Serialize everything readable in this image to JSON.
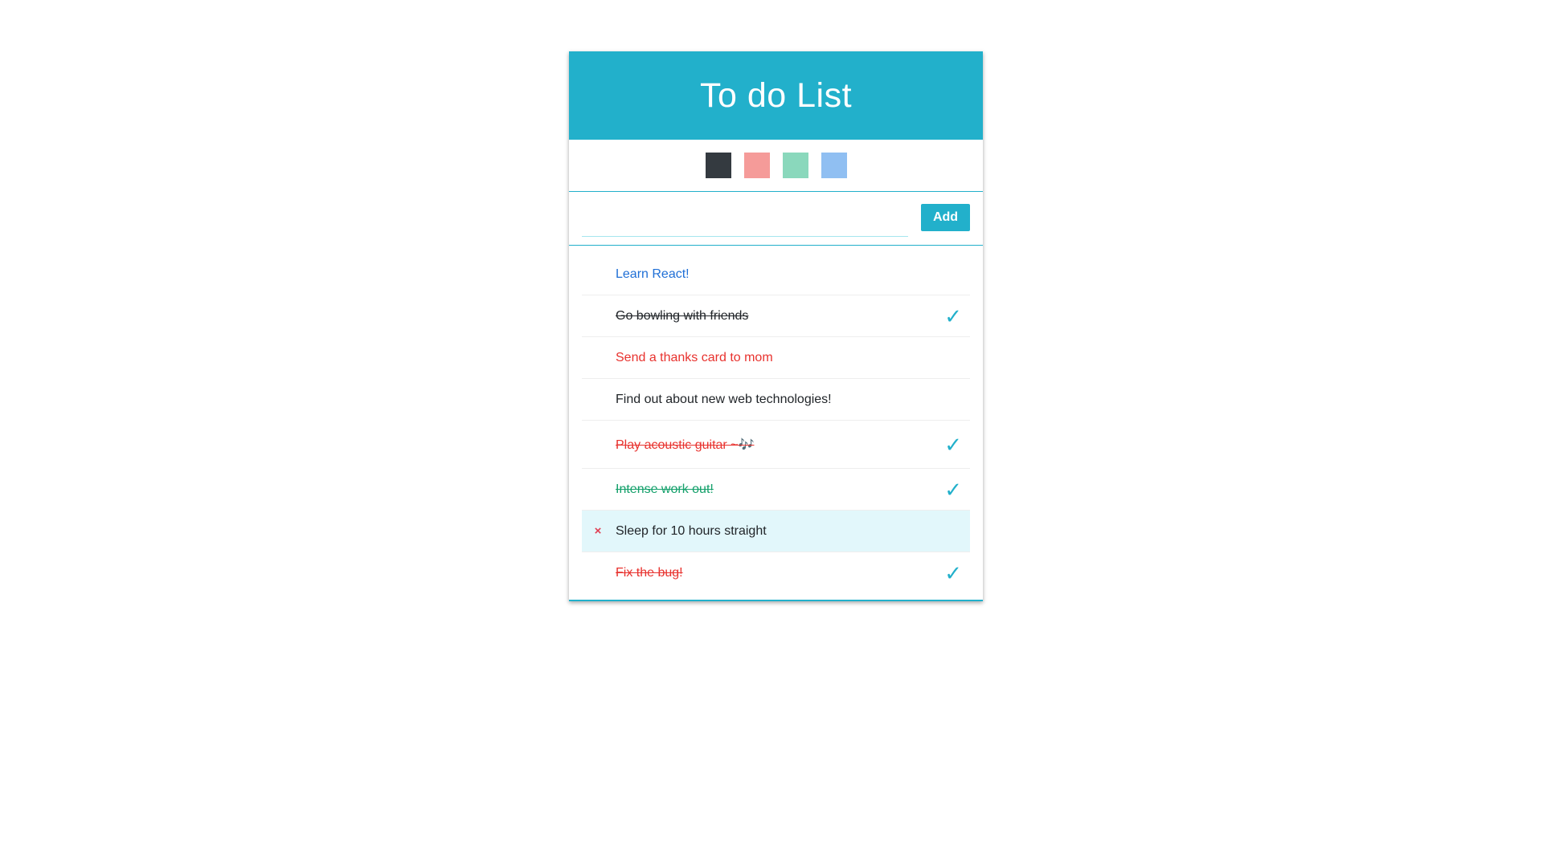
{
  "header": {
    "title": "To do List"
  },
  "palette": [
    {
      "name": "dark",
      "color": "#343a40"
    },
    {
      "name": "pink",
      "color": "#f59b99"
    },
    {
      "name": "mint",
      "color": "#8ad8bc"
    },
    {
      "name": "blue",
      "color": "#90bff2"
    }
  ],
  "form": {
    "input_value": "",
    "add_label": "Add"
  },
  "todos": [
    {
      "text": "Learn React!",
      "color": "#1f6fd6",
      "checked": false
    },
    {
      "text": "Go bowling with friends",
      "color": "#212529",
      "checked": true
    },
    {
      "text": "Send a thanks card to mom",
      "color": "#e8322e",
      "checked": false
    },
    {
      "text": "Find out about new web technologies!",
      "color": "#212529",
      "checked": false
    },
    {
      "text": "Play acoustic guitar ~🎶",
      "color": "#e8322e",
      "checked": true
    },
    {
      "text": "Intense work out!",
      "color": "#14a06b",
      "checked": true
    },
    {
      "text": "Sleep for 10 hours straight",
      "color": "#212529",
      "checked": false,
      "hovered": true
    },
    {
      "text": "Fix the bug!",
      "color": "#e8322e",
      "checked": true
    }
  ],
  "icons": {
    "remove": "×",
    "check": "✓"
  }
}
